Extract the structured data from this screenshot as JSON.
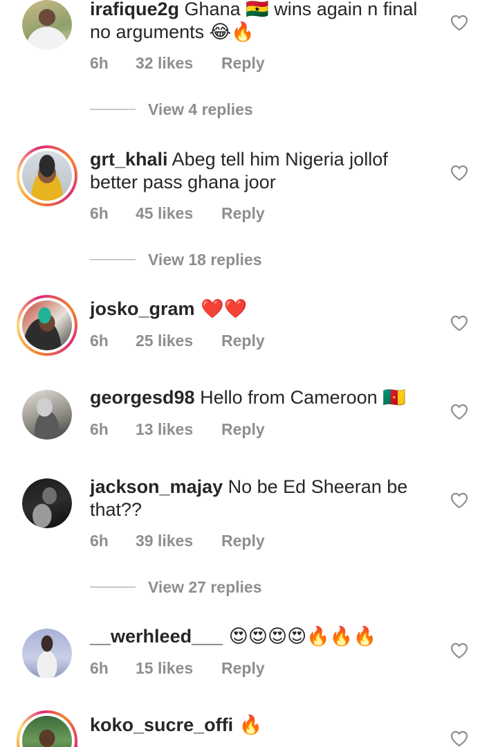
{
  "comments": [
    {
      "username": "irafique2g",
      "text": " Ghana 🇬🇭 wins again n final no arguments 😂🔥",
      "time": "6h",
      "likes": "32 likes",
      "reply": "Reply",
      "view_replies": "View 4 replies"
    },
    {
      "username": "grt_khali",
      "text": " Abeg tell him Nigeria jollof better pass ghana joor",
      "time": "6h",
      "likes": "45 likes",
      "reply": "Reply",
      "view_replies": "View 18 replies"
    },
    {
      "username": "josko_gram",
      "text": " ❤️❤️",
      "time": "6h",
      "likes": "25 likes",
      "reply": "Reply"
    },
    {
      "username": "georgesd98",
      "text": " Hello from Cameroon 🇨🇲",
      "time": "6h",
      "likes": "13 likes",
      "reply": "Reply"
    },
    {
      "username": "jackson_majay",
      "text": " No be Ed Sheeran be that??",
      "time": "6h",
      "likes": "39 likes",
      "reply": "Reply",
      "view_replies": "View 27 replies"
    },
    {
      "username": "__werhleed___",
      "text": " 😍😍😍😍🔥🔥🔥",
      "time": "6h",
      "likes": "15 likes",
      "reply": "Reply"
    },
    {
      "username": "koko_sucre_offi",
      "text": " 🔥"
    }
  ],
  "icons": {
    "heart": "heart-outline-icon"
  },
  "colors": {
    "text": "#262626",
    "secondary": "#8e8e8e",
    "story_ring_start": "#f58529",
    "story_ring_end": "#dd2a7b"
  }
}
